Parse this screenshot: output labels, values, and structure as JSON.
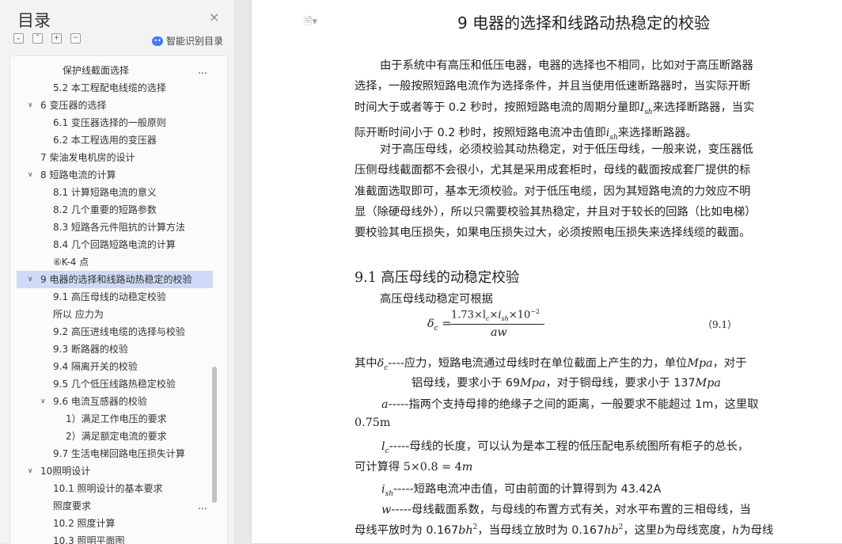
{
  "sidebar": {
    "title": "目录",
    "close": "×",
    "tools": [
      "⌄",
      "⌃",
      "+",
      "−"
    ],
    "smart_label": "智能识别目录",
    "items": [
      {
        "label": "保护线截面选择",
        "level": 3,
        "more": "…"
      },
      {
        "label": "5.2 本工程配电线缆的选择",
        "level": 2
      },
      {
        "label": "6   变压器的选择",
        "level": 1,
        "chevron": "∨"
      },
      {
        "label": "6.1 变压器选择的一般原则",
        "level": 2
      },
      {
        "label": "6.2 本工程选用的变压器",
        "level": 2
      },
      {
        "label": "7   柴油发电机房的设计",
        "level": 1
      },
      {
        "label": "8   短路电流的计算",
        "level": 1,
        "chevron": "∨"
      },
      {
        "label": "8.1 计算短路电流的意义",
        "level": 2
      },
      {
        "label": "8.2 几个重要的短路参数",
        "level": 2
      },
      {
        "label": "8.3 短路各元件阻抗的计算方法",
        "level": 2
      },
      {
        "label": "8.4   几个回路短路电流的计算",
        "level": 2
      },
      {
        "label": "⑥K-4 点",
        "level": 2
      },
      {
        "label": "9   电器的选择和线路动热稳定的校验",
        "level": 1,
        "chevron": "∨",
        "active": true
      },
      {
        "label": "9.1 高压母线的动稳定校验",
        "level": 2
      },
      {
        "label": "所以 应力为",
        "level": 2
      },
      {
        "label": "9.2 高压进线电缆的选择与校验",
        "level": 2
      },
      {
        "label": "9.3 断路器的校验",
        "level": 2
      },
      {
        "label": "9.4 隔离开关的校验",
        "level": 2
      },
      {
        "label": "9.5 几个低压线路热稳定校验",
        "level": 2
      },
      {
        "label": "9.6 电流互感器的校验",
        "level": 2,
        "chevron": "∨"
      },
      {
        "label": "1）满足工作电压的要求",
        "level": 4
      },
      {
        "label": "2）满足额定电流的要求",
        "level": 4
      },
      {
        "label": "9.7 生活电梯回路电压损失计算",
        "level": 2
      },
      {
        "label": "10照明设计",
        "level": 1,
        "chevron": "∨"
      },
      {
        "label": "10.1 照明设计的基本要求",
        "level": 2
      },
      {
        "label": "照度要求",
        "level": 2,
        "more": "…"
      },
      {
        "label": "10.2 照度计算",
        "level": 2
      },
      {
        "label": "10.3 照明平面图",
        "level": 2
      }
    ]
  },
  "doc": {
    "page_icon": "🗎▾",
    "heading": "9   电器的选择和线路动热稳定的校验",
    "p1": [
      "由于系统中有高压和低压电器，电器的选择也不相同，比如对于高压断路器",
      "选择，一般按照短路电流作为选择条件，并且当使用低速断路器时，当实际开断",
      "时间大于或者等于 0.2 秒时，按照短路电流的周期分量即",
      "I",
      "sh",
      "来选择断路器，当实",
      "际开断时间小于 0.2 秒时，按照短路电流冲击值即",
      "i",
      "sh",
      "来选择断路器。"
    ],
    "p2": [
      "对于高压母线，必须校验其动热稳定，对于低压母线，一般来说，变压器低",
      "压侧母线截面都不会很小，尤其是采用成套柜时，母线的截面按成套厂提供的标",
      "准截面选取即可，基本无须校验。对于低压电缆，因为其短路电流的力效应不明",
      "显（除硬母线外），所以只需要校验其热稳定，并且对于较长的回路（比如电梯）",
      "要校验其电压损失，如果电压损失过大，必须按照电压损失来选择线缆的截面。"
    ],
    "h2": "9.1 高压母线的动稳定校验",
    "intro": "高压母线动稳定可根据",
    "formula": {
      "lhs": "δ",
      "lhs_sub": "c",
      "numerator": "1.73×l",
      "num_sub": "c",
      "num_mid": "×i",
      "num_sub2": "sh",
      "num_end": "×10",
      "num_sup": "−2",
      "denominator": "aw",
      "eq_no": "（9.1）"
    },
    "defs": {
      "d1a": "其中",
      "d1_sym": "δ",
      "d1_sub": "c",
      "d1b": "----应力，短路电流通过母线时在单位截面上产生的力，单位",
      "d1_unit": "Mpa",
      "d1c": "，对于",
      "d2a": "铝母线，要求小于 69",
      "d2_unit1": "Mpa",
      "d2b": "，对于铜母线，要求小于 137",
      "d2_unit2": "Mpa",
      "a_sym": "a",
      "a_text": "-----指两个支持母排的绝缘子之间的距离，一般要求不能超过 1m，这里取",
      "a_val": "0.75m",
      "l_sym": "l",
      "l_sub": "c",
      "l_text": "-----母线的长度，可以认为是本工程的低压配电系统图所有柜子的总长，",
      "l_calc_a": "可计算得",
      "l_calc_b": "5×0.8 = 4",
      "l_calc_m": "m",
      "i_sym": "i",
      "i_sub": "sh",
      "i_text": "-----短路电流冲击值，可由前面的计算得到为 43.42A",
      "w_sym": "w",
      "w_text": "-----母线截面系数，与母线的布置方式有关，对水平布置的三相母线，当",
      "w2a": "母线平放时为 0.167",
      "w2_bh": "bh",
      "w2_sup": "2",
      "w2b": "，当母线立放时为 0.167",
      "w2_hb": "hb",
      "w2_sup2": "2",
      "w2c": "，这里",
      "w2_b": "b",
      "w2d": "为母线宽度，",
      "w2_h": "h",
      "w2e": "为母线"
    }
  }
}
